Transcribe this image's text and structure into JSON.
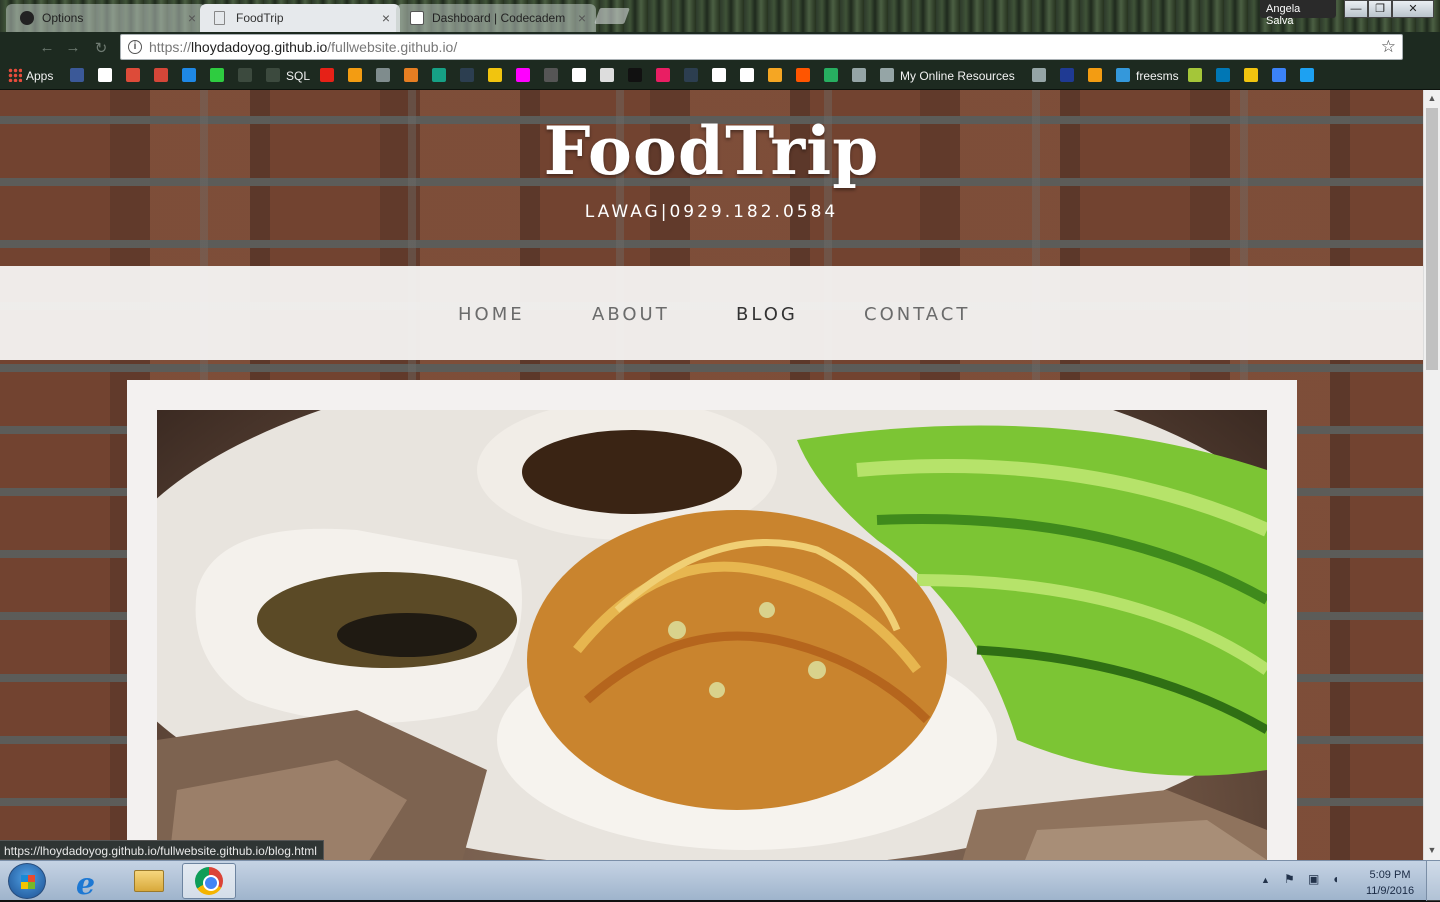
{
  "browser": {
    "tabs": [
      {
        "title": "Options",
        "icon": "github-icon",
        "active": false
      },
      {
        "title": "FoodTrip",
        "icon": "page-icon",
        "active": true
      },
      {
        "title": "Dashboard | Codecadem",
        "icon": "codecademy-icon",
        "active": false
      }
    ],
    "tab_close_glyph": "×",
    "profile_name": "Angela Salva",
    "window_controls": {
      "minimize": "—",
      "restore": "❐",
      "close": "✕"
    },
    "nav": {
      "back": "←",
      "forward": "→",
      "reload": "↻"
    },
    "address": {
      "scheme": "https://",
      "host": "lhoydadoyog.github.io",
      "path": "/fullwebsite.github.io/",
      "info_glyph": "i",
      "star_glyph": "☆"
    },
    "bookmarks": [
      {
        "label": "Apps",
        "icon": "apps-grid-icon",
        "color": "#e74c3c"
      },
      {
        "label": "",
        "icon": "facebook-icon",
        "color": "#3b5998"
      },
      {
        "label": "",
        "icon": "google-icon",
        "color": "#ffffff"
      },
      {
        "label": "",
        "icon": "google-plus-icon",
        "color": "#dd4b39"
      },
      {
        "label": "",
        "icon": "gmail-icon",
        "color": "#d44638"
      },
      {
        "label": "",
        "icon": "shield-bookmark-icon",
        "color": "#1e88e5"
      },
      {
        "label": "",
        "icon": "lightning-bookmark-icon",
        "color": "#2ecc40"
      },
      {
        "label": "",
        "icon": "blank-page-icon",
        "color": "#3c4a3e"
      },
      {
        "label": "SQL",
        "icon": "sql-icon",
        "color": "#3c4a3e"
      },
      {
        "label": "",
        "icon": "youtube-icon",
        "color": "#e62117"
      },
      {
        "label": "",
        "icon": "bookmark-9-icon",
        "color": "#f39c12"
      },
      {
        "label": "",
        "icon": "bookmark-10-icon",
        "color": "#7f8c8d"
      },
      {
        "label": "",
        "icon": "bookmark-11-icon",
        "color": "#e67e22"
      },
      {
        "label": "",
        "icon": "bookmark-12-icon",
        "color": "#16a085"
      },
      {
        "label": "",
        "icon": "bookmark-13-icon",
        "color": "#2c3e50"
      },
      {
        "label": "",
        "icon": "bookmark-14-icon",
        "color": "#f1c40f"
      },
      {
        "label": "",
        "icon": "bookmark-15-icon",
        "color": "#ff00ff"
      },
      {
        "label": "",
        "icon": "bookmark-16-icon",
        "color": "#555555"
      },
      {
        "label": "",
        "icon": "bookmark-17-icon",
        "color": "#ffffff"
      },
      {
        "label": "",
        "icon": "bookmark-18-icon",
        "color": "#dddddd"
      },
      {
        "label": "",
        "icon": "bookmark-19-icon",
        "color": "#111111"
      },
      {
        "label": "",
        "icon": "bookmark-20-icon",
        "color": "#e91e63"
      },
      {
        "label": "",
        "icon": "bookmark-21-icon",
        "color": "#2c3e50"
      },
      {
        "label": "",
        "icon": "bookmark-22-icon",
        "color": "#ffffff"
      },
      {
        "label": "",
        "icon": "bookmark-23-icon",
        "color": "#ffffff"
      },
      {
        "label": "",
        "icon": "bookmark-24-icon",
        "color": "#f5a623"
      },
      {
        "label": "",
        "icon": "soundcloud-icon",
        "color": "#ff5500"
      },
      {
        "label": "",
        "icon": "bookmark-26-icon",
        "color": "#27ae60"
      },
      {
        "label": "",
        "icon": "bookmark-27-icon",
        "color": "#95a5a6"
      },
      {
        "label": "My Online Resources",
        "icon": "folder-bookmark-icon",
        "color": "#95a5a6"
      },
      {
        "label": "",
        "icon": "bookmark-29-icon",
        "color": "#95a5a6"
      },
      {
        "label": "",
        "icon": "bookmark-30-icon",
        "color": "#1f3a93"
      },
      {
        "label": "",
        "icon": "bookmark-31-icon",
        "color": "#f39c12"
      },
      {
        "label": "freesms",
        "icon": "freesms-icon",
        "color": "#3498db"
      },
      {
        "label": "",
        "icon": "android-icon",
        "color": "#a4c639"
      },
      {
        "label": "",
        "icon": "linkedin-icon",
        "color": "#0077b5"
      },
      {
        "label": "",
        "icon": "bookmark-35-icon",
        "color": "#f1c40f"
      },
      {
        "label": "",
        "icon": "bookmark-36-icon",
        "color": "#3b82f6"
      },
      {
        "label": "",
        "icon": "bookmark-37-icon",
        "color": "#1da1f2"
      }
    ],
    "status_url": "https://lhoydadoyog.github.io/fullwebsite.github.io/blog.html",
    "scroll_position": 0.0
  },
  "site": {
    "title": "FoodTrip",
    "subtitle": "LAWAG|0929.182.0584",
    "nav": [
      {
        "label": "HOME",
        "current": false
      },
      {
        "label": "ABOUT",
        "current": false
      },
      {
        "label": "BLOG",
        "current": true
      },
      {
        "label": "CONTACT",
        "current": false
      }
    ],
    "hero_image": "food-photo-noodles-dipping-sauces-cucumber-meat"
  },
  "taskbar": {
    "pinned": [
      {
        "name": "internet-explorer",
        "label": "e"
      },
      {
        "name": "file-explorer"
      },
      {
        "name": "chrome",
        "active": true
      }
    ],
    "tray_arrow": "▲",
    "clock_time": "5:09 PM",
    "clock_date": "11/9/2016"
  },
  "colors": {
    "page_nav_text": "#6b6b6b",
    "page_nav_current": "#333333",
    "brick": "#8b4c33",
    "card_bg": "#f3f1f0"
  }
}
